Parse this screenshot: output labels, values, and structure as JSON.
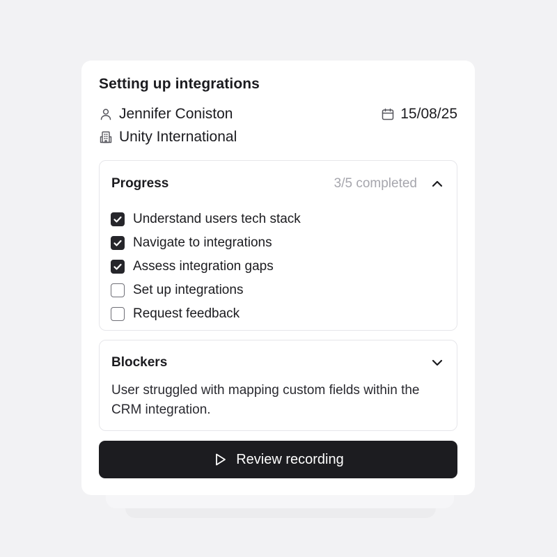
{
  "task": {
    "title": "Setting up integrations",
    "assignee": "Jennifer Coniston",
    "assignee_icon": "user-icon",
    "company": "Unity International",
    "company_icon": "building-icon",
    "date": "15/08/25",
    "date_icon": "calendar-icon"
  },
  "progress": {
    "title": "Progress",
    "count": "3/5 completed",
    "completed": 3,
    "total": 5,
    "expanded": true,
    "toggle_icon": "chevron-up-icon",
    "items": [
      {
        "label": "Understand users tech stack",
        "checked": true
      },
      {
        "label": "Navigate to integrations",
        "checked": true
      },
      {
        "label": "Assess integration gaps",
        "checked": true
      },
      {
        "label": "Set up integrations",
        "checked": false
      },
      {
        "label": "Request feedback",
        "checked": false
      }
    ]
  },
  "blockers": {
    "title": "Blockers",
    "toggle_icon": "chevron-down-icon",
    "text": "User struggled with mapping custom fields within the CRM integration."
  },
  "action": {
    "label": "Review recording",
    "icon": "play-icon"
  },
  "colors": {
    "background": "#f2f2f4",
    "card": "#ffffff",
    "button": "#1c1c20",
    "checkbox_checked": "#26262b",
    "muted_text": "#a6a6ad"
  }
}
